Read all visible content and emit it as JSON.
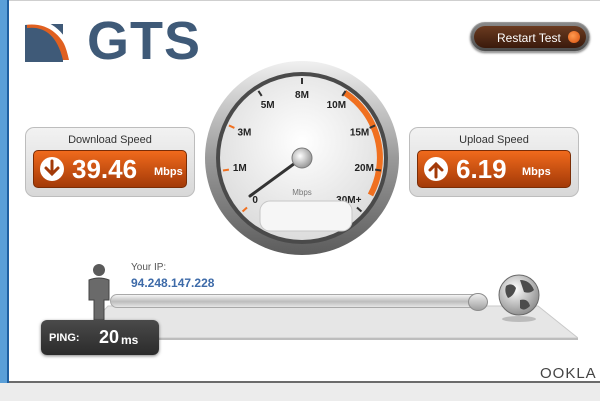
{
  "brand": {
    "logo_text": "GTS",
    "logo_color": "#3f5a78",
    "logo_accent": "#e06020"
  },
  "restart_button": {
    "label": "Restart Test"
  },
  "download": {
    "title": "Download Speed",
    "value": "39.46",
    "unit": "Mbps",
    "icon": "arrow-down-icon"
  },
  "upload": {
    "title": "Upload Speed",
    "value": "6.19",
    "unit": "Mbps",
    "icon": "arrow-up-icon"
  },
  "gauge": {
    "unit_label": "Mbps",
    "ticks": [
      "0",
      "1M",
      "3M",
      "5M",
      "8M",
      "10M",
      "15M",
      "20M",
      "30M+"
    ],
    "needle_value": "0",
    "accent": "#f07020"
  },
  "connection": {
    "ip_label": "Your IP:",
    "ip_value": "94.248.147.228"
  },
  "ping": {
    "label": "PING:",
    "value": "20",
    "unit": "ms"
  },
  "footer": {
    "vendor": "OOKLA"
  },
  "colors": {
    "orange": "#e85e14",
    "dark_orange": "#a33a08",
    "ip_blue": "#3d6aa8"
  }
}
